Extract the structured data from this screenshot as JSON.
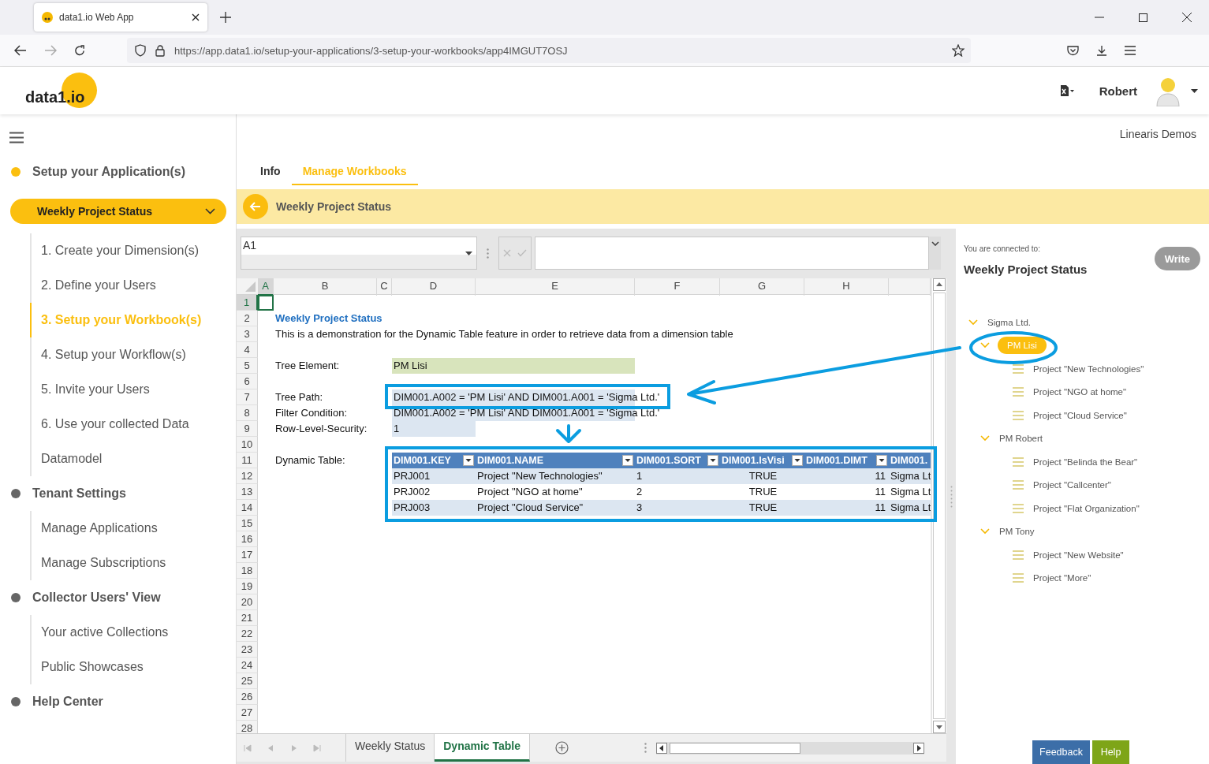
{
  "browser": {
    "tab_title": "data1.io Web App",
    "url": "https://app.data1.io/setup-your-applications/3-setup-your-workbooks/app4IMGUT7OSJ"
  },
  "header": {
    "logo": "data1.io",
    "user": "Robert"
  },
  "sidebar": {
    "sections": [
      {
        "title": "Setup your Application(s)",
        "active": true,
        "app_selector": "Weekly Project Status",
        "items": [
          {
            "label": "1. Create your Dimension(s)",
            "selected": false
          },
          {
            "label": "2. Define your Users",
            "selected": false
          },
          {
            "label": "3. Setup your Workbook(s)",
            "selected": true
          },
          {
            "label": "4. Setup your Workflow(s)",
            "selected": false
          },
          {
            "label": "5. Invite your Users",
            "selected": false
          },
          {
            "label": "6. Use your collected Data",
            "selected": false
          },
          {
            "label": "Datamodel",
            "selected": false
          }
        ]
      },
      {
        "title": "Tenant Settings",
        "active": false,
        "items": [
          {
            "label": "Manage Applications",
            "selected": false
          },
          {
            "label": "Manage Subscriptions",
            "selected": false
          }
        ]
      },
      {
        "title": "Collector Users' View",
        "active": false,
        "items": [
          {
            "label": "Your active Collections",
            "selected": false
          },
          {
            "label": "Public Showcases",
            "selected": false
          }
        ]
      },
      {
        "title": "Help Center",
        "active": false
      }
    ]
  },
  "tenant": "Linearis Demos",
  "tabs": [
    {
      "label": "Info",
      "selected": false
    },
    {
      "label": "Manage Workbooks",
      "selected": true
    }
  ],
  "workbook_title": "Weekly Project Status",
  "sheet": {
    "name_box": "A1",
    "columns": [
      {
        "label": "A",
        "selected": true
      },
      {
        "label": "B",
        "selected": false
      },
      {
        "label": "C",
        "selected": false
      },
      {
        "label": "D",
        "selected": false
      },
      {
        "label": "E",
        "selected": false
      },
      {
        "label": "F",
        "selected": false
      },
      {
        "label": "G",
        "selected": false
      },
      {
        "label": "H",
        "selected": false
      }
    ],
    "rows": [
      {
        "label": "1",
        "selected": true
      },
      {
        "label": "2",
        "selected": false
      },
      {
        "label": "3",
        "selected": false
      },
      {
        "label": "4",
        "selected": false
      },
      {
        "label": "5",
        "selected": false
      },
      {
        "label": "6",
        "selected": false
      },
      {
        "label": "7",
        "selected": false
      },
      {
        "label": "8",
        "selected": false
      },
      {
        "label": "9",
        "selected": false
      },
      {
        "label": "10",
        "selected": false
      },
      {
        "label": "11",
        "selected": false
      },
      {
        "label": "12",
        "selected": false
      },
      {
        "label": "13",
        "selected": false
      },
      {
        "label": "14",
        "selected": false
      },
      {
        "label": "15",
        "selected": false
      },
      {
        "label": "16",
        "selected": false
      },
      {
        "label": "17",
        "selected": false
      },
      {
        "label": "18",
        "selected": false
      },
      {
        "label": "19",
        "selected": false
      },
      {
        "label": "20",
        "selected": false
      },
      {
        "label": "21",
        "selected": false
      },
      {
        "label": "22",
        "selected": false
      },
      {
        "label": "23",
        "selected": false
      },
      {
        "label": "24",
        "selected": false
      },
      {
        "label": "25",
        "selected": false
      },
      {
        "label": "26",
        "selected": false
      },
      {
        "label": "27",
        "selected": false
      },
      {
        "label": "28",
        "selected": false
      }
    ],
    "title": "Weekly Project Status",
    "description": "This is a demonstration for the Dynamic Table feature in order to retrieve data from a dimension table",
    "fields": [
      {
        "label": "Tree Element:",
        "value": "PM Lisi",
        "kind": "input"
      },
      {
        "label": "Tree Path:",
        "value": "DIM001.A002 = 'PM Lisi' AND DIM001.A001 = 'Sigma Ltd.'",
        "kind": "formula"
      },
      {
        "label": "Filter Condition:",
        "value": "DIM001.A002 = 'PM Lisi' AND DIM001.A001 = 'Sigma Ltd.'",
        "kind": "formula"
      },
      {
        "label": "Row-Level-Security:",
        "value": "1",
        "kind": "number"
      }
    ],
    "table_label": "Dynamic Table:",
    "table": {
      "columns": [
        "DIM001.KEY",
        "DIM001.NAME",
        "DIM001.SORT",
        "DIM001.IsVisi",
        "DIM001.DIMT",
        "DIM001."
      ],
      "rows": [
        [
          "PRJ001",
          "Project \"New Technologies\"",
          "1",
          "TRUE",
          "11",
          "Sigma Lt"
        ],
        [
          "PRJ002",
          "Project \"NGO at home\"",
          "2",
          "TRUE",
          "11",
          "Sigma Lt"
        ],
        [
          "PRJ003",
          "Project \"Cloud Service\"",
          "3",
          "TRUE",
          "11",
          "Sigma Lt"
        ]
      ]
    },
    "sheet_tabs": [
      {
        "label": "Weekly Status",
        "selected": false
      },
      {
        "label": "Dynamic Table",
        "selected": true
      }
    ]
  },
  "panel": {
    "connected_label": "You are connected to:",
    "title": "Weekly Project Status",
    "write_button": "Write",
    "tree": [
      {
        "label": "Sigma Ltd.",
        "expanded": true,
        "selected": false,
        "children": [
          {
            "label": "PM Lisi",
            "expanded": true,
            "selected": true,
            "children": [
              {
                "label": "Project \"New Technologies\""
              },
              {
                "label": "Project \"NGO at home\""
              },
              {
                "label": "Project \"Cloud Service\""
              }
            ]
          },
          {
            "label": "PM Robert",
            "expanded": true,
            "selected": false,
            "children": [
              {
                "label": "Project \"Belinda the Bear\""
              },
              {
                "label": "Project \"Callcenter\""
              },
              {
                "label": "Project \"Flat Organization\""
              }
            ]
          },
          {
            "label": "PM Tony",
            "expanded": true,
            "selected": false,
            "children": [
              {
                "label": "Project \"New Website\""
              },
              {
                "label": "Project \"More\""
              }
            ]
          }
        ]
      }
    ]
  },
  "feedback_button": "Feedback",
  "help_button": "Help"
}
